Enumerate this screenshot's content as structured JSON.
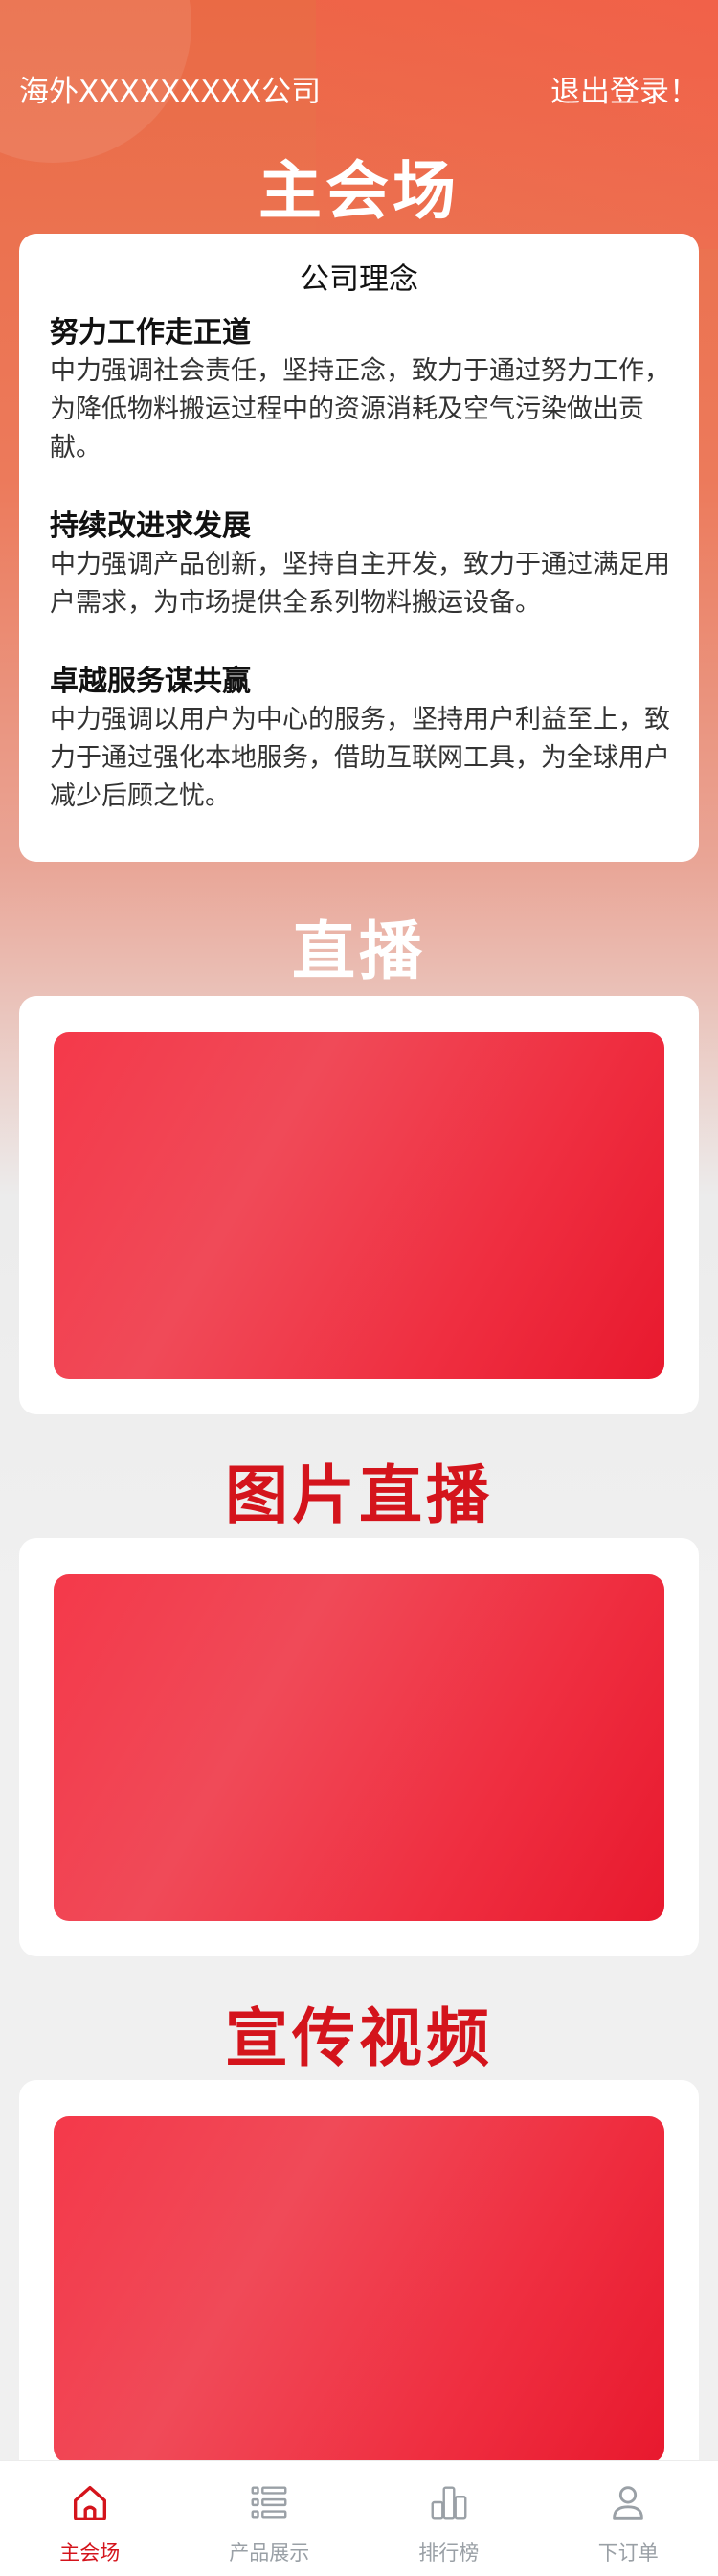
{
  "header": {
    "company": "海外XXXXXXXXX公司",
    "logout": "退出登录！"
  },
  "sections": {
    "main": "主会场",
    "live": "直播",
    "photo_live": "图片直播",
    "promo_video": "宣传视频"
  },
  "philosophy": {
    "heading": "公司理念",
    "items": [
      {
        "title": "努力工作走正道",
        "text": "中力强调社会责任，坚持正念，致力于通过努力工作，为降低物料搬运过程中的资源消耗及空气污染做出贡献。"
      },
      {
        "title": "持续改进求发展",
        "text": "中力强调产品创新，坚持自主开发，致力于通过满足用户需求，为市场提供全系列物料搬运设备。"
      },
      {
        "title": "卓越服务谋共赢",
        "text": "中力强调以用户为中心的服务，坚持用户利益至上，致力于通过强化本地服务，借助互联网工具，为全球用户减少后顾之忧。"
      }
    ]
  },
  "tabbar": {
    "tabs": [
      {
        "label": "主会场",
        "icon": "home-icon",
        "active": true
      },
      {
        "label": "产品展示",
        "icon": "list-icon",
        "active": false
      },
      {
        "label": "排行榜",
        "icon": "bar-chart-icon",
        "active": false
      },
      {
        "label": "下订单",
        "icon": "user-icon",
        "active": false
      }
    ]
  },
  "colors": {
    "accent_red": "#d4141c",
    "media_red": "#ef2e40",
    "tab_inactive": "#9aa0a6"
  }
}
